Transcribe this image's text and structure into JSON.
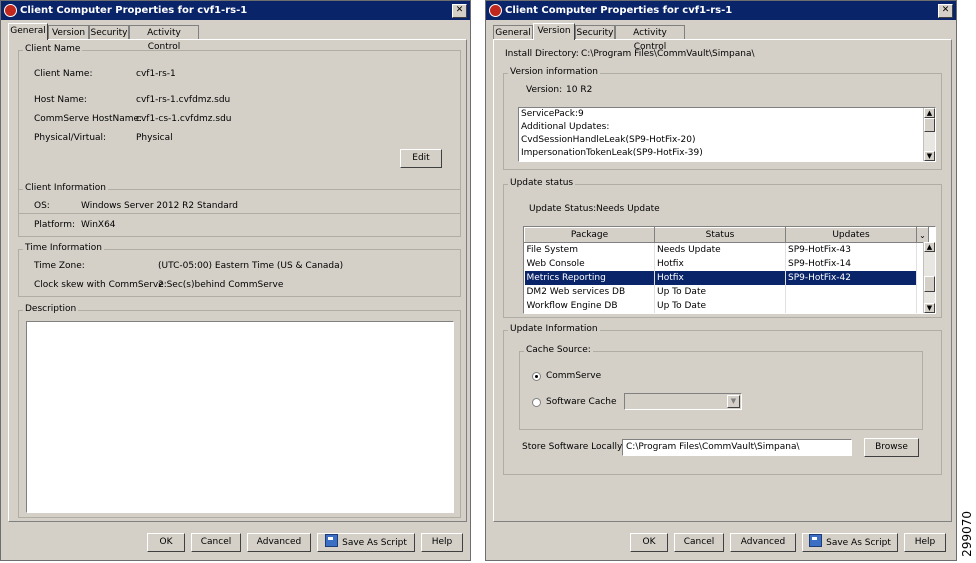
{
  "left": {
    "title": "Client Computer Properties for cvf1-rs-1",
    "tabs": [
      "General",
      "Version",
      "Security",
      "Activity Control"
    ],
    "client_name_group": {
      "title": "Client Name",
      "client_name_label": "Client Name:",
      "client_name_value": "cvf1-rs-1",
      "host_name_label": "Host Name:",
      "host_name_value": "cvf1-rs-1.cvfdmz.sdu",
      "commserve_label": "CommServe HostName:",
      "commserve_value": "cvf1-cs-1.cvfdmz.sdu",
      "physvirt_label": "Physical/Virtual:",
      "physvirt_value": "Physical",
      "edit_label": "Edit"
    },
    "client_info_group": {
      "title": "Client Information",
      "os_label": "OS:",
      "os_value": "Windows Server 2012 R2 Standard",
      "platform_label": "Platform:",
      "platform_value": "WinX64"
    },
    "time_group": {
      "title": "Time Information",
      "tz_label": "Time Zone:",
      "tz_value": "(UTC-05:00) Eastern Time (US & Canada)",
      "skew_label": "Clock skew with CommServe:",
      "skew_value": "2 Sec(s)behind CommServe"
    },
    "description_group": {
      "title": "Description",
      "value": ""
    },
    "buttons": {
      "ok": "OK",
      "cancel": "Cancel",
      "advanced": "Advanced",
      "save_script": "Save As Script",
      "help": "Help"
    }
  },
  "right": {
    "title": "Client Computer Properties for cvf1-rs-1",
    "tabs": [
      "General",
      "Version",
      "Security",
      "Activity Control"
    ],
    "install_dir_label": "Install Directory:",
    "install_dir_value": "C:\\Program Files\\CommVault\\Simpana\\",
    "version_group": {
      "title": "Version information",
      "version_label": "Version:",
      "version_value": "10 R2",
      "lines": [
        "ServicePack:9",
        "Additional Updates:",
        "CvdSessionHandleLeak(SP9-HotFix-20)",
        "ImpersonationTokenLeak(SP9-HotFix-39)"
      ]
    },
    "update_group": {
      "title": "Update status",
      "status_label": "Update Status:",
      "status_value": "Needs Update",
      "columns": [
        "Package",
        "Status",
        "Updates"
      ],
      "rows": [
        [
          "File System",
          "Needs Update",
          "SP9-HotFix-43"
        ],
        [
          "Web Console",
          "Hotfix",
          "SP9-HotFix-14"
        ],
        [
          "Metrics Reporting",
          "Hotfix",
          "SP9-HotFix-42"
        ],
        [
          "DM2 Web services DB",
          "Up To Date",
          ""
        ],
        [
          "Workflow Engine DB",
          "Up To Date",
          ""
        ]
      ],
      "selected_row": 2
    },
    "update_info_group": {
      "title": "Update Information",
      "cache_source_title": "Cache Source:",
      "commserve_label": "CommServe",
      "software_cache_label": "Software Cache",
      "software_cache_value": "",
      "store_label": "Store Software Locally:",
      "store_value": "C:\\Program Files\\CommVault\\Simpana\\",
      "browse_label": "Browse"
    },
    "buttons": {
      "ok": "OK",
      "cancel": "Cancel",
      "advanced": "Advanced",
      "save_script": "Save As Script",
      "help": "Help"
    }
  },
  "watermark": "299070",
  "colors": {
    "titlebar": "#0a246a",
    "selection": "#0a246a",
    "dialog": "#d4d0c8"
  },
  "icons": [
    "app-icon",
    "close-icon",
    "save-script-icon",
    "scroll-up-icon",
    "scroll-down-icon",
    "column-chooser-icon",
    "dropdown-arrow-icon"
  ]
}
